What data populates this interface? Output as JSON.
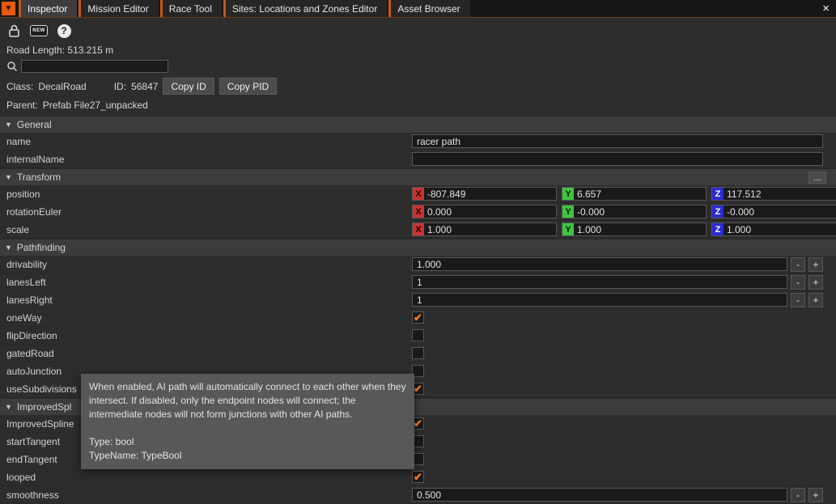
{
  "glyphs": {
    "collapse": "▼",
    "check": "✔",
    "minus": "-",
    "plus": "+",
    "more": "...",
    "close": "×",
    "help": "?",
    "new": "NEW"
  },
  "colors": {
    "accent_orange": "#e8590c",
    "check_orange": "#ff7b1c",
    "axis_x_red": "#cb3434",
    "axis_y_green": "#3fc43f",
    "axis_z_blue": "#2a2ad2"
  },
  "tab_bar": {
    "tabs": [
      {
        "label": "Inspector"
      },
      {
        "label": "Mission Editor"
      },
      {
        "label": "Race Tool"
      },
      {
        "label": "Sites: Locations and Zones Editor"
      },
      {
        "label": "Asset Browser"
      }
    ]
  },
  "info": {
    "road_length": "Road Length: 513.215 m",
    "class_label": "Class:",
    "class_value": "DecalRoad",
    "id_label": "ID:",
    "id_value": "56847",
    "copy_id_button": "Copy ID",
    "copy_pid_button": "Copy PID",
    "parent_label": "Parent:",
    "parent_value": "Prefab File27_unpacked"
  },
  "search": {
    "value": ""
  },
  "axis_labels": {
    "x": "X",
    "y": "Y",
    "z": "Z"
  },
  "sections": {
    "general": {
      "title": "General",
      "rows": [
        {
          "label": "name",
          "value": "racer path"
        },
        {
          "label": "internalName",
          "value": ""
        }
      ]
    },
    "transform": {
      "title": "Transform",
      "rows": [
        {
          "label": "position",
          "x": "-807.849",
          "y": "6.657",
          "z": "117.512"
        },
        {
          "label": "rotationEuler",
          "x": "0.000",
          "y": "-0.000",
          "z": "-0.000"
        },
        {
          "label": "scale",
          "x": "1.000",
          "y": "1.000",
          "z": "1.000"
        }
      ]
    },
    "pathfinding": {
      "title": "Pathfinding",
      "numeric_rows": [
        {
          "label": "drivability",
          "value": "1.000"
        },
        {
          "label": "lanesLeft",
          "value": "1"
        },
        {
          "label": "lanesRight",
          "value": "1"
        }
      ],
      "checkbox_rows": [
        {
          "label": "oneWay",
          "mark": "✔"
        },
        {
          "label": "flipDirection",
          "mark": ""
        },
        {
          "label": "gatedRoad",
          "mark": ""
        },
        {
          "label": "autoJunction",
          "mark": ""
        },
        {
          "label": "useSubdivisions",
          "mark": "✔"
        }
      ]
    },
    "improved_spline": {
      "title": "ImprovedSpl",
      "checkbox_rows": [
        {
          "label": "ImprovedSpline",
          "mark": "✔"
        },
        {
          "label": "startTangent",
          "mark": ""
        },
        {
          "label": "endTangent",
          "mark": ""
        },
        {
          "label": "looped",
          "mark": "✔"
        }
      ],
      "numeric_rows": [
        {
          "label": "smoothness",
          "value": "0.500"
        }
      ]
    }
  },
  "tooltip": {
    "body": "When enabled, AI path will automatically connect to each other when they intersect. If disabled, only the endpoint nodes will connect; the intermediate nodes will not form junctions with other AI paths.",
    "type_line": "Type: bool",
    "typename_line": "TypeName: TypeBool"
  }
}
